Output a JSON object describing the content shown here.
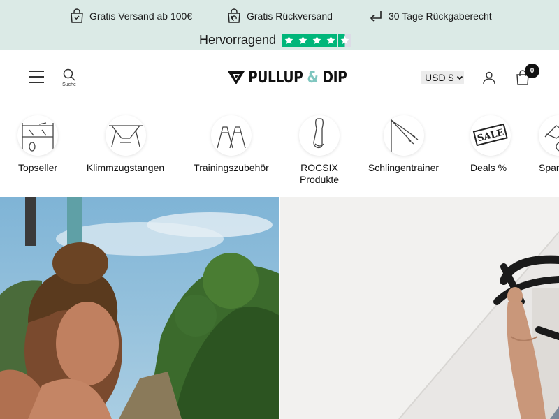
{
  "announcement": {
    "usps": [
      {
        "label": "Gratis Versand ab 100€",
        "icon": "shopping-bag-check-icon"
      },
      {
        "label": "Gratis Rückversand",
        "icon": "return-bag-icon"
      },
      {
        "label": "30 Tage Rückgaberecht",
        "icon": "return-arrow-icon"
      }
    ],
    "trust_label": "Hervorragend",
    "trust_rating": 4.5,
    "trust_max": 5,
    "trust_color": "#00b67a",
    "background": "#dbeae6"
  },
  "header": {
    "search_label": "Suche",
    "logo_text_1": "PULLUP",
    "logo_amp": "&",
    "logo_text_2": "DIP",
    "logo_accent": "#7fc6bf",
    "currency": "USD $",
    "cart_count": "0"
  },
  "categories": [
    {
      "label": "Topseller",
      "icon": "pullup-station-icon"
    },
    {
      "label": "Klimmzugstangen",
      "icon": "pullup-bar-icon"
    },
    {
      "label": "Trainingszubehör",
      "icon": "parallettes-icon"
    },
    {
      "label_line1": "ROCSIX",
      "label_line2": "Produkte",
      "icon": "resistance-band-icon"
    },
    {
      "label": "Schlingentrainer",
      "icon": "sling-trainer-icon"
    },
    {
      "label": "Deals %",
      "icon": "sale-tag-icon",
      "tag_text": "SALE"
    },
    {
      "label": "Spar",
      "icon": "bundle-icon"
    }
  ],
  "hero": {
    "left_image": "man-with-bun-outdoors-photo",
    "right_image": "arm-gripping-pullup-bar-photo"
  }
}
